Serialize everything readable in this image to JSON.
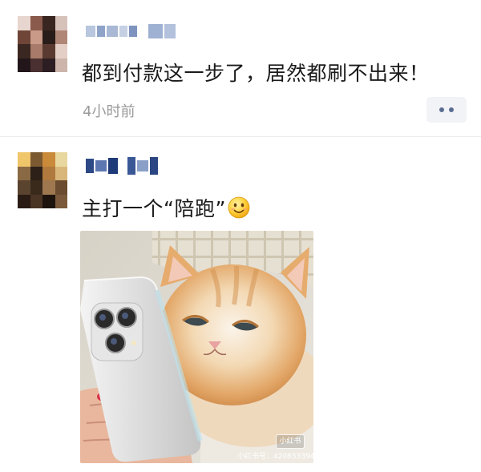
{
  "posts": [
    {
      "author": "",
      "message": "都到付款这一步了，居然都刷不出来！",
      "time": "4小时前"
    },
    {
      "author": "",
      "message": "主打一个“陪跑”",
      "emoji": "slightly-smiling-face",
      "image": {
        "description_name": "cat-with-phone-photo",
        "watermark_badge": "小红书",
        "watermark_id": "小红书号：420653394"
      }
    }
  ],
  "colors": {
    "text": "#1a1a1a",
    "muted": "#9a9a9a",
    "more_button_bg": "#f2f3f7",
    "more_dots": "#5a6d90"
  },
  "icons": [
    "more-icon",
    "emoji-smile-icon"
  ]
}
